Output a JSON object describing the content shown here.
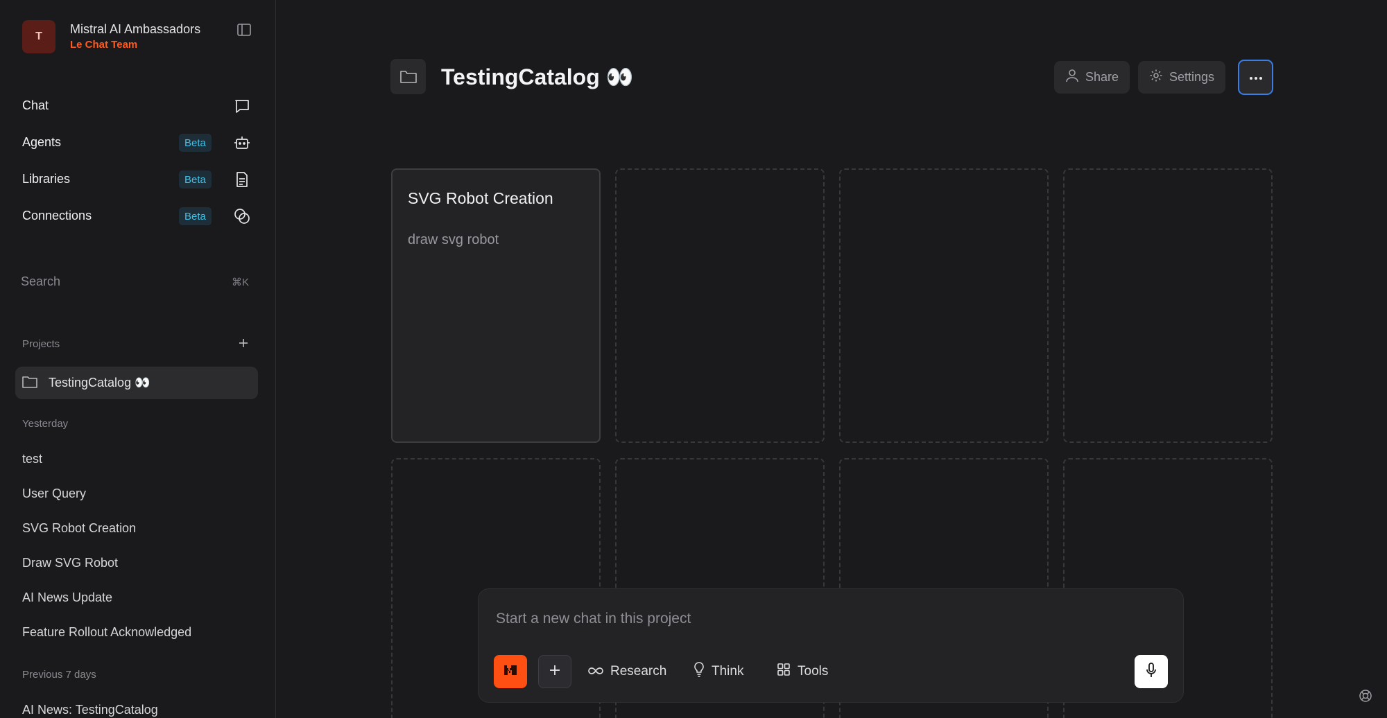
{
  "workspace": {
    "avatar_letter": "T",
    "name": "Mistral AI Ambassadors",
    "team": "Le Chat Team"
  },
  "nav": [
    {
      "label": "Chat",
      "badge": "",
      "icon": "chat-bubble-icon"
    },
    {
      "label": "Agents",
      "badge": "Beta",
      "icon": "robot-icon"
    },
    {
      "label": "Libraries",
      "badge": "Beta",
      "icon": "document-icon"
    },
    {
      "label": "Connections",
      "badge": "Beta",
      "icon": "connections-icon"
    }
  ],
  "search": {
    "placeholder": "Search",
    "shortcut": "⌘K"
  },
  "projects": {
    "heading": "Projects",
    "items": [
      {
        "label": "TestingCatalog 👀"
      }
    ]
  },
  "history": {
    "yesterday_heading": "Yesterday",
    "yesterday": [
      "test",
      "User Query",
      "SVG Robot Creation",
      "Draw SVG Robot",
      "AI News Update",
      "Feature Rollout Acknowledged"
    ],
    "previous_heading": "Previous 7 days",
    "previous": [
      "AI News: TestingCatalog"
    ]
  },
  "main": {
    "title": "TestingCatalog 👀",
    "share_label": "Share",
    "settings_label": "Settings",
    "cards": [
      {
        "title": "SVG Robot Creation",
        "description": "draw svg robot"
      }
    ]
  },
  "composer": {
    "placeholder": "Start a new chat in this project",
    "research_label": "Research",
    "think_label": "Think",
    "tools_label": "Tools"
  },
  "colors": {
    "accent": "#ff4f12",
    "team_text": "#ff5a1f",
    "badge_text": "#3fc1e6",
    "focus_ring": "#3b7de0"
  }
}
